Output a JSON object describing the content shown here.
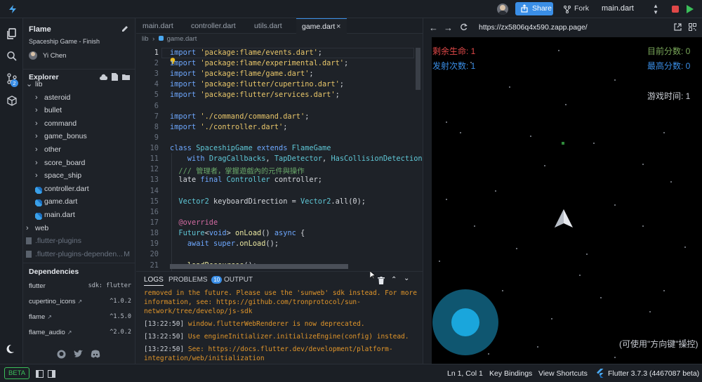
{
  "topbar": {
    "share_label": "Share",
    "fork_label": "Fork",
    "file_select": "main.dart"
  },
  "sidebar": {
    "project_title": "Flame",
    "project_subtitle": "Spaceship Game - Finish",
    "author": "Yi Chen",
    "explorer_label": "Explorer",
    "git_badge": "2",
    "tree": [
      {
        "label": "lib",
        "type": "folder-open",
        "indent": 0
      },
      {
        "label": "asteroid",
        "type": "folder",
        "indent": 1
      },
      {
        "label": "bullet",
        "type": "folder",
        "indent": 1
      },
      {
        "label": "command",
        "type": "folder",
        "indent": 1
      },
      {
        "label": "game_bonus",
        "type": "folder",
        "indent": 1
      },
      {
        "label": "other",
        "type": "folder",
        "indent": 1
      },
      {
        "label": "score_board",
        "type": "folder",
        "indent": 1
      },
      {
        "label": "space_ship",
        "type": "folder",
        "indent": 1
      },
      {
        "label": "controller.dart",
        "type": "dart",
        "indent": 1
      },
      {
        "label": "game.dart",
        "type": "dart",
        "indent": 1
      },
      {
        "label": "main.dart",
        "type": "dart",
        "indent": 1
      },
      {
        "label": "web",
        "type": "folder",
        "indent": 0
      },
      {
        "label": ".flutter-plugins",
        "type": "file-dim",
        "indent": 0
      },
      {
        "label": ".flutter-plugins-dependen...",
        "type": "file-dim",
        "indent": 0,
        "badge": "M"
      }
    ],
    "dependencies_label": "Dependencies",
    "dependencies": [
      {
        "name": "flutter",
        "version": "sdk: flutter",
        "link": false
      },
      {
        "name": "cupertino_icons",
        "version": "^1.0.2",
        "link": true
      },
      {
        "name": "flame",
        "version": "^1.5.0",
        "link": true
      },
      {
        "name": "flame_audio",
        "version": "^2.0.2",
        "link": true
      }
    ]
  },
  "editor": {
    "tabs": [
      "main.dart",
      "controller.dart",
      "utils.dart",
      "game.dart"
    ],
    "active_tab": "game.dart",
    "breadcrumb": [
      "lib",
      "game.dart"
    ],
    "lines": [
      "1",
      "2",
      "3",
      "4",
      "5",
      "6",
      "7",
      "8",
      "9",
      "10",
      "11",
      "12",
      "13",
      "14",
      "15",
      "16",
      "17",
      "18",
      "19",
      "20",
      "21"
    ]
  },
  "logs": {
    "tabs": [
      "LOGS",
      "PROBLEMS",
      "OUTPUT"
    ],
    "problems_count": "10",
    "lines": [
      {
        "ts": "",
        "text": "removed in the future. Please use the 'sunweb' sdk instead. For more"
      },
      {
        "ts": "",
        "text": "information, see: https://github.com/tronprotocol/sun-"
      },
      {
        "ts": "",
        "text": "network/tree/develop/js-sdk"
      },
      {
        "ts": "[13:22:50]",
        "text": " window.flutterWebRenderer is now deprecated."
      },
      {
        "ts": "[13:22:50]",
        "text": " Use engineInitializer.initializeEngine(config) instead."
      },
      {
        "ts": "[13:22:50]",
        "text": " See: https://docs.flutter.dev/development/platform-"
      },
      {
        "ts": "",
        "text": "integration/web/initialization"
      }
    ]
  },
  "preview": {
    "url": "https://zx5806q4x590.zapp.page/",
    "game": {
      "lives": "剩余生命: 1",
      "shots": "发射次数: 1",
      "score": "目前分数: 0",
      "high_score": "最高分数: 0",
      "time": "游戏时间: 1",
      "hint": "(可使用\"方向键\"操控)"
    }
  },
  "status": {
    "beta": "BETA",
    "cursor": "Ln 1, Col 1",
    "key_bindings": "Key Bindings",
    "view_shortcuts": "View Shortcuts",
    "flutter_version": "Flutter 3.7.3",
    "flutter_build": "(4467087 beta)"
  },
  "colors": {
    "accent": "#3a8ee6",
    "log_warn": "#e0952a",
    "lives_red": "#e04848",
    "shots_blue": "#3a8ee6",
    "score_green": "#7aa85a",
    "joystick_outer": "#0f5670",
    "joystick_inner": "#1aa6dc"
  }
}
